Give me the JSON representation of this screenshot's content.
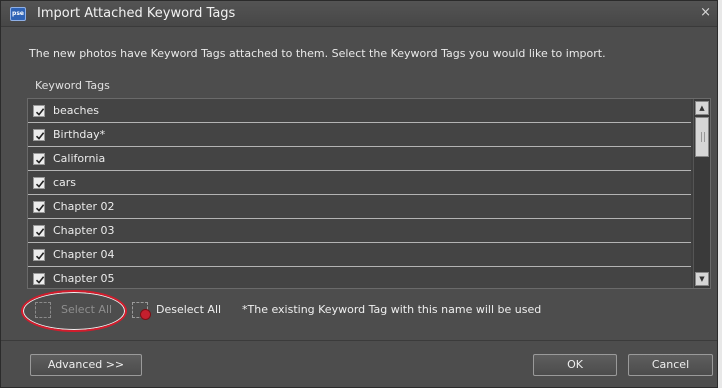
{
  "window": {
    "title": "Import Attached Keyword Tags",
    "app_icon_text": "pse",
    "close_glyph": "×"
  },
  "instruction": "The new photos have Keyword Tags attached to them.  Select the Keyword Tags you would like to import.",
  "list": {
    "header": "Keyword Tags",
    "items": [
      {
        "label": "beaches",
        "checked": true
      },
      {
        "label": "Birthday*",
        "checked": true
      },
      {
        "label": "California",
        "checked": true
      },
      {
        "label": "cars",
        "checked": true
      },
      {
        "label": "Chapter 02",
        "checked": true
      },
      {
        "label": "Chapter 03",
        "checked": true
      },
      {
        "label": "Chapter 04",
        "checked": true
      },
      {
        "label": "Chapter 05",
        "checked": true
      }
    ]
  },
  "actions": {
    "select_all": "Select All",
    "deselect_all": "Deselect All",
    "note": "*The existing Keyword Tag with this name will be used"
  },
  "buttons": {
    "advanced": "Advanced >>",
    "ok": "OK",
    "cancel": "Cancel"
  },
  "colors": {
    "dialog_bg": "#4d4d4d",
    "highlight_ring": "#d21c2c"
  }
}
